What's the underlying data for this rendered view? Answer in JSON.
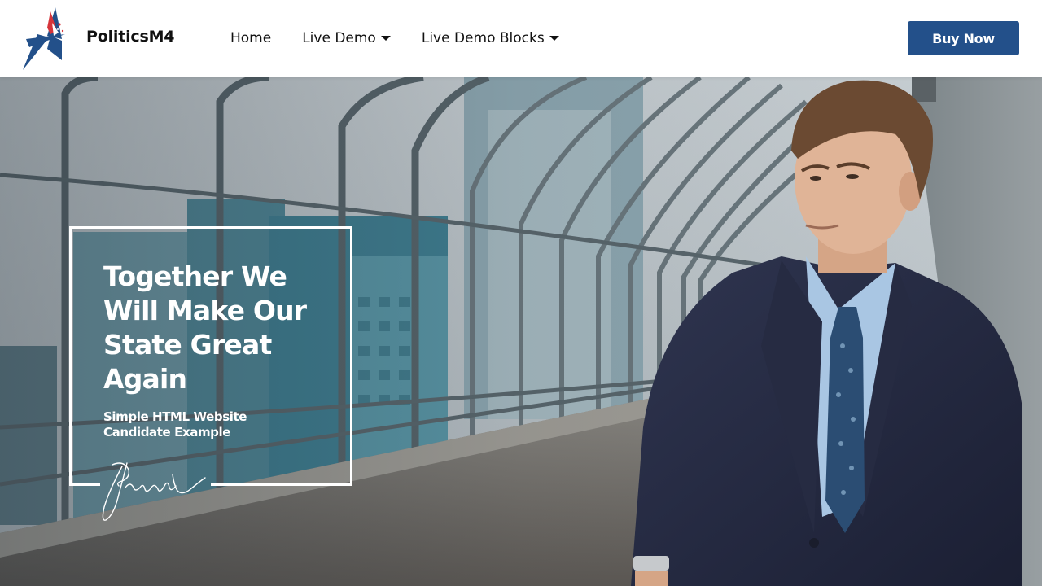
{
  "brand": {
    "name": "PoliticsM4",
    "logo_icon": "star-logo-icon"
  },
  "nav": {
    "items": [
      {
        "label": "Home",
        "has_dropdown": false
      },
      {
        "label": "Live Demo",
        "has_dropdown": true
      },
      {
        "label": "Live Demo Blocks",
        "has_dropdown": true
      }
    ],
    "cta_label": "Buy Now"
  },
  "hero": {
    "title": "Together We Will Make Our State Great Again",
    "subtitle": "Simple HTML Website Candidate Example",
    "background": "man-in-suit-on-rooftop-walkway-photo",
    "signature_icon": "handwritten-signature"
  },
  "colors": {
    "accent": "#23508a",
    "logo_blue": "#23508a",
    "logo_red": "#d6343a",
    "text": "#111111",
    "hero_text": "#ffffff"
  }
}
